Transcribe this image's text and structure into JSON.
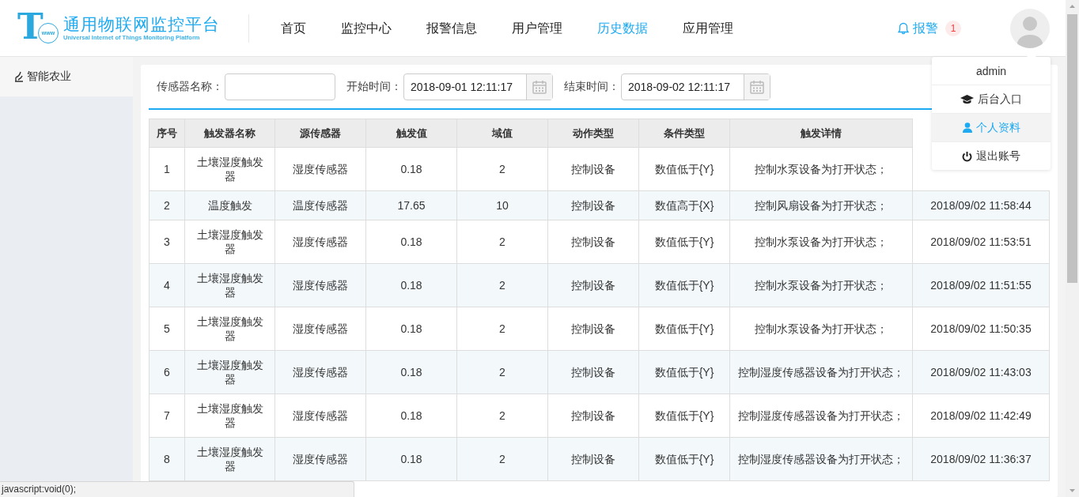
{
  "logo": {
    "letter": "T",
    "globe_text": "www",
    "title": "通用物联网监控平台",
    "subtitle": "Universal Internet of Things Monitoring Platform"
  },
  "nav": {
    "items": [
      {
        "label": "首页",
        "selected": false
      },
      {
        "label": "监控中心",
        "selected": false
      },
      {
        "label": "报警信息",
        "selected": false
      },
      {
        "label": "用户管理",
        "selected": false
      },
      {
        "label": "历史数据",
        "selected": true
      },
      {
        "label": "应用管理",
        "selected": false
      }
    ]
  },
  "alerts": {
    "label": "报警",
    "count": "1"
  },
  "user_menu": {
    "username": "admin",
    "items": [
      {
        "label": "后台入口",
        "kind": "cap",
        "selected": false
      },
      {
        "label": "个人资料",
        "kind": "user",
        "selected": true
      },
      {
        "label": "退出账号",
        "kind": "power",
        "selected": false
      }
    ]
  },
  "sidebar": {
    "items": [
      {
        "label": "智能农业",
        "selected": true
      }
    ]
  },
  "filters": {
    "sensor_label": "传感器名称：",
    "start_label": "开始时间：",
    "start_value": "2018-09-01 12:11:17",
    "end_label": "结束时间：",
    "end_value": "2018-09-02 12:11:17"
  },
  "table": {
    "columns": [
      "序号",
      "触发器名称",
      "源传感器",
      "触发值",
      "域值",
      "动作类型",
      "条件类型",
      "触发详情"
    ],
    "rows": [
      [
        "1",
        "土壤湿度触发器",
        "湿度传感器",
        "0.18",
        "2",
        "控制设备",
        "数值低于{Y}",
        "控制水泵设备为打开状态；"
      ],
      [
        "2",
        "温度触发",
        "温度传感器",
        "17.65",
        "10",
        "控制设备",
        "数值高于{X}",
        "控制风扇设备为打开状态；",
        "2018/09/02 11:58:44"
      ],
      [
        "3",
        "土壤湿度触发器",
        "湿度传感器",
        "0.18",
        "2",
        "控制设备",
        "数值低于{Y}",
        "控制水泵设备为打开状态；",
        "2018/09/02 11:53:51"
      ],
      [
        "4",
        "土壤湿度触发器",
        "湿度传感器",
        "0.18",
        "2",
        "控制设备",
        "数值低于{Y}",
        "控制水泵设备为打开状态；",
        "2018/09/02 11:51:55"
      ],
      [
        "5",
        "土壤湿度触发器",
        "湿度传感器",
        "0.18",
        "2",
        "控制设备",
        "数值低于{Y}",
        "控制水泵设备为打开状态；",
        "2018/09/02 11:50:35"
      ],
      [
        "6",
        "土壤湿度触发器",
        "湿度传感器",
        "0.18",
        "2",
        "控制设备",
        "数值低于{Y}",
        "控制湿度传感器设备为打开状态；",
        "2018/09/02 11:43:03"
      ],
      [
        "7",
        "土壤湿度触发器",
        "湿度传感器",
        "0.18",
        "2",
        "控制设备",
        "数值低于{Y}",
        "控制湿度传感器设备为打开状态；",
        "2018/09/02 11:42:49"
      ],
      [
        "8",
        "土壤湿度触发器",
        "湿度传感器",
        "0.18",
        "2",
        "控制设备",
        "数值低于{Y}",
        "控制湿度传感器设备为打开状态；",
        "2018/09/02 11:36:37"
      ]
    ]
  },
  "status_bar": {
    "text": "javascript:void(0);"
  }
}
